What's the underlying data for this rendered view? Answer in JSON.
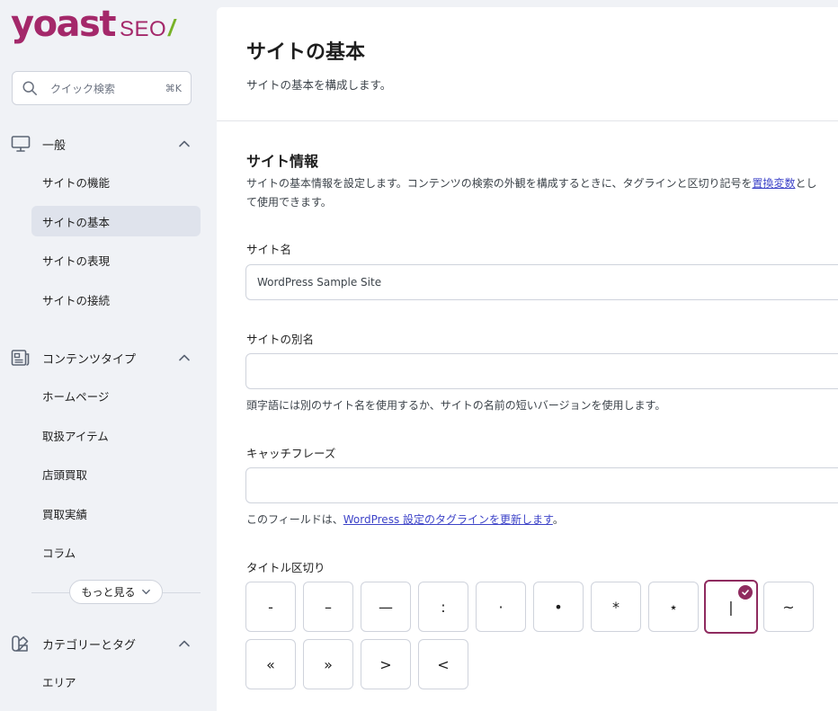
{
  "brand": {
    "logo_main": "yoast",
    "logo_sub": "SEO",
    "logo_mark": "/",
    "color_primary": "#a4286a",
    "color_accent": "#77b227"
  },
  "search": {
    "placeholder": "クイック検索",
    "shortcut": "⌘K",
    "icon": "search-icon"
  },
  "sidebar": {
    "sections": [
      {
        "title": "一般",
        "icon": "desktop-icon",
        "items": [
          "サイトの機能",
          "サイトの基本",
          "サイトの表現",
          "サイトの接続"
        ],
        "active": "サイトの基本"
      },
      {
        "title": "コンテンツタイプ",
        "icon": "newspaper-icon",
        "items": [
          "ホームページ",
          "取扱アイテム",
          "店頭買取",
          "買取実績",
          "コラム"
        ]
      },
      {
        "title": "カテゴリーとタグ",
        "icon": "color-swatch-icon",
        "items": [
          "エリア"
        ]
      }
    ],
    "more_label": "もっと見る"
  },
  "main": {
    "title": "サイトの基本",
    "description": "サイトの基本を構成します。",
    "section": {
      "title": "サイト情報",
      "desc_text": "サイトの基本情報を設定します。コンテンツの検索の外観を構成するときに、タグラインと区切り記号を",
      "desc_link": "置換変数",
      "desc_suffix": "として使用できます。"
    },
    "fields": {
      "site_name": {
        "label": "サイト名",
        "value": "WordPress Sample Site"
      },
      "alt_name": {
        "label": "サイトの別名",
        "value": "",
        "hint": "頭字語には別のサイト名を使用するか、サイトの名前の短いバージョンを使用します。"
      },
      "tagline": {
        "label": "キャッチフレーズ",
        "value": "",
        "hint_prefix": "このフィールドは、",
        "hint_link": "WordPress 設定のタグラインを更新します",
        "hint_suffix": "。"
      }
    },
    "separator": {
      "label": "タイトル区切り",
      "options": [
        "-",
        "–",
        "—",
        ":",
        "·",
        "•",
        "*",
        "⋆",
        "|",
        "~",
        "«",
        "»",
        ">",
        "<"
      ],
      "selected": "|",
      "selected_color": "#8f2b5f"
    }
  }
}
